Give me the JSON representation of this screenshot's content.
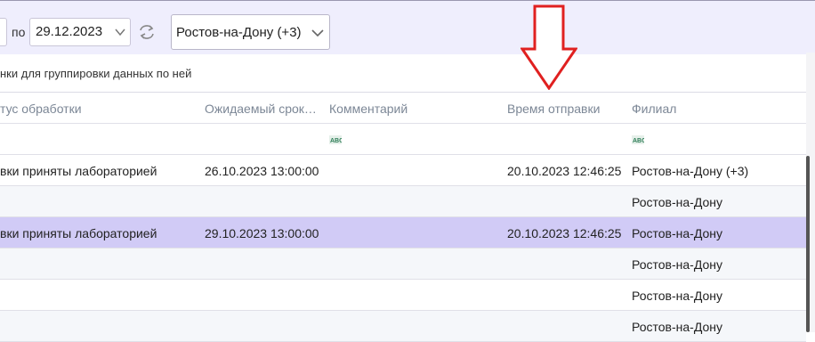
{
  "toolbar": {
    "to_label": "по",
    "date_to": "29.12.2023",
    "city": "Ростов-на-Дону (+3)"
  },
  "group_hint": "нки для группировки данных по ней",
  "columns": [
    "тус обработки",
    "Ожидаемый срок…",
    "Комментарий",
    "Время отправки",
    "Филиал"
  ],
  "rows": [
    {
      "status": "вки приняты лабораторией",
      "due": "26.10.2023 13:00:00",
      "comment": "",
      "sent": "20.10.2023 12:46:25",
      "branch": "Ростов-на-Дону (+3)"
    },
    {
      "status": "",
      "due": "",
      "comment": "",
      "sent": "",
      "branch": "Ростов-на-Дону"
    },
    {
      "status": "вки приняты лабораторией",
      "due": "29.10.2023 13:00:00",
      "comment": "",
      "sent": "20.10.2023 12:46:25",
      "branch": "Ростов-на-Дону"
    },
    {
      "status": "",
      "due": "",
      "comment": "",
      "sent": "",
      "branch": "Ростов-на-Дону"
    },
    {
      "status": "",
      "due": "",
      "comment": "",
      "sent": "",
      "branch": "Ростов-на-Дону"
    },
    {
      "status": "",
      "due": "",
      "comment": "",
      "sent": "",
      "branch": "Ростов-на-Дону"
    }
  ],
  "colors": {
    "selected_row": "#d1cbf6",
    "toolbar_bg": "#efeefd",
    "arrow": "#e02020"
  },
  "icons": {
    "refresh": "refresh-icon",
    "chevron": "chevron-down-icon",
    "filter": "text-filter-icon",
    "arrow": "down-arrow-annotation"
  }
}
